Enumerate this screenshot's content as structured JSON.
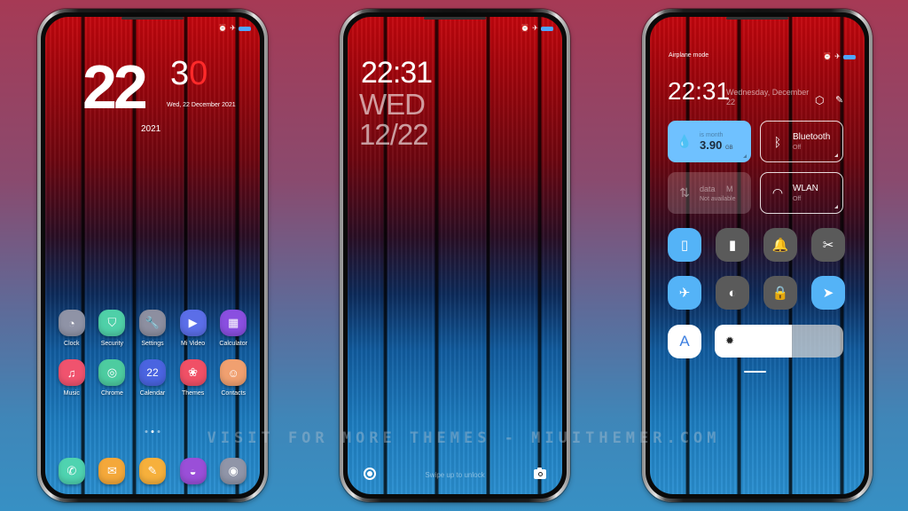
{
  "background": {
    "top_color": "#a63a55",
    "bottom_color": "#3790c4"
  },
  "watermark": "VISIT FOR MORE THEMES - MIUITHEMER.COM",
  "status_bar": {
    "icons": [
      "alarm-icon",
      "airplane-icon",
      "battery-icon"
    ],
    "battery_color": "#4fa6ff"
  },
  "home_screen": {
    "clock": {
      "hours": "22",
      "minute_first": "3",
      "minute_second": "0",
      "minute_accent_color": "#ff2a2a"
    },
    "date_text": "Wed, 22 December 2021",
    "year_text": "2021",
    "apps": [
      {
        "label": "Clock",
        "icon": "clock-icon",
        "color": "#8f93a6",
        "glyph": "◔"
      },
      {
        "label": "Security",
        "icon": "shield-icon",
        "color": "#4fd0a8",
        "glyph": "⛉"
      },
      {
        "label": "Settings",
        "icon": "wrench-icon",
        "color": "#8d8fa0",
        "glyph": "🔧"
      },
      {
        "label": "Mi Video",
        "icon": "play-icon",
        "color": "#5b6ee8",
        "glyph": "▶"
      },
      {
        "label": "Calculator",
        "icon": "calculator-icon",
        "color": "#8a4fe0",
        "glyph": "▦"
      },
      {
        "label": "Music",
        "icon": "music-icon",
        "color": "#f0536e",
        "glyph": "♫"
      },
      {
        "label": "Chrome",
        "icon": "chrome-icon",
        "color": "#4dcca0",
        "glyph": "◎"
      },
      {
        "label": "Calendar",
        "icon": "calendar-icon",
        "color": "#4a64e0",
        "glyph": "22"
      },
      {
        "label": "Themes",
        "icon": "themes-icon",
        "color": "#f05066",
        "glyph": "❀"
      },
      {
        "label": "Contacts",
        "icon": "contacts-icon",
        "color": "#f0a070",
        "glyph": "☺"
      }
    ],
    "page_indicator": {
      "total": 3,
      "active": 1
    },
    "dock": [
      {
        "name": "phone",
        "icon": "phone-icon",
        "color": "#4fd3b0",
        "glyph": "✆"
      },
      {
        "name": "messaging",
        "icon": "message-icon",
        "color": "#f4a83a",
        "glyph": "✉"
      },
      {
        "name": "notes",
        "icon": "notes-icon",
        "color": "#f6b03c",
        "glyph": "✎"
      },
      {
        "name": "browser",
        "icon": "browser-icon",
        "color": "#9a4fd8",
        "glyph": "◒"
      },
      {
        "name": "camera",
        "icon": "camera-icon",
        "color": "#9095a8",
        "glyph": "◉"
      }
    ]
  },
  "lock_screen": {
    "time": "22:31",
    "day": "WED",
    "date": "12/22",
    "swipe_hint": "Swipe up to unlock"
  },
  "control_center": {
    "mode_label": "Airplane mode",
    "time": "22:31",
    "date": "Wednesday, December 22",
    "data_tile": {
      "top_label": "is month",
      "value": "3.90",
      "unit": "GB"
    },
    "mobile_tile": {
      "title": "data",
      "title_right": "M",
      "subtitle": "Not available"
    },
    "bluetooth_tile": {
      "title": "Bluetooth",
      "status": "Off"
    },
    "wlan_tile": {
      "title": "WLAN",
      "status": "Off"
    },
    "toggles": [
      {
        "name": "vibrate",
        "icon": "vibrate-icon",
        "glyph": "▯",
        "on": true
      },
      {
        "name": "flashlight",
        "icon": "flashlight-icon",
        "glyph": "▮",
        "on": false
      },
      {
        "name": "mute",
        "icon": "bell-icon",
        "glyph": "🔔",
        "on": false
      },
      {
        "name": "screenshot",
        "icon": "screenshot-icon",
        "glyph": "✂",
        "on": false
      },
      {
        "name": "airplane",
        "icon": "airplane-icon",
        "glyph": "✈",
        "on": true
      },
      {
        "name": "dark-mode",
        "icon": "dark-mode-icon",
        "glyph": "◐",
        "on": false
      },
      {
        "name": "lock-screen",
        "icon": "lock-icon",
        "glyph": "🔒",
        "on": false
      },
      {
        "name": "location",
        "icon": "location-icon",
        "glyph": "➤",
        "on": true
      }
    ],
    "auto_brightness_label": "A",
    "brightness_percent": 60
  }
}
